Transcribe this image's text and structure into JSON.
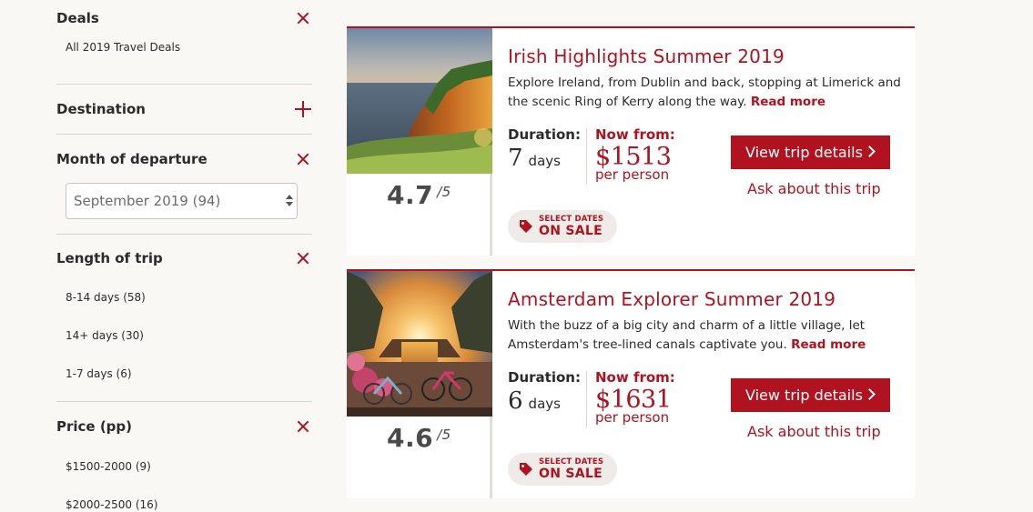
{
  "sidebar": {
    "deals": {
      "label": "Deals",
      "options": [
        "All 2019 Travel Deals"
      ]
    },
    "destination": {
      "label": "Destination"
    },
    "month": {
      "label": "Month of departure",
      "selected": "September 2019 (94)"
    },
    "length": {
      "label": "Length of trip",
      "options": [
        "8-14 days (58)",
        "14+ days (30)",
        "1-7 days (6)"
      ]
    },
    "price": {
      "label": "Price (pp)",
      "options": [
        "$1500-2000 (9)",
        "$2000-2500 (16)"
      ]
    }
  },
  "trips": [
    {
      "title": "Irish Highlights Summer 2019",
      "description": "Explore Ireland, from Dublin and back, stopping at Limerick and the scenic Ring of Kerry along the way.",
      "read_more": "Read more",
      "rating": "4.7",
      "rating_max": "/5",
      "duration_label": "Duration:",
      "duration_value": "7",
      "duration_unit": "days",
      "price_label": "Now from:",
      "price_currency": "$",
      "price_value": "1513",
      "price_unit": "per person",
      "cta": "View trip details",
      "ask": "Ask about this trip",
      "badge_small": "SELECT DATES",
      "badge_big": "ON SALE"
    },
    {
      "title": "Amsterdam Explorer Summer 2019",
      "description": "With the buzz of a big city and charm of a little village, let Amsterdam's tree-lined canals captivate you.",
      "read_more": "Read more",
      "rating": "4.6",
      "rating_max": "/5",
      "duration_label": "Duration:",
      "duration_value": "6",
      "duration_unit": "days",
      "price_label": "Now from:",
      "price_currency": "$",
      "price_value": "1631",
      "price_unit": "per person",
      "cta": "View trip details",
      "ask": "Ask about this trip",
      "badge_small": "SELECT DATES",
      "badge_big": "ON SALE"
    }
  ],
  "colors": {
    "accent": "#b0121f",
    "background": "#faf8f5"
  }
}
